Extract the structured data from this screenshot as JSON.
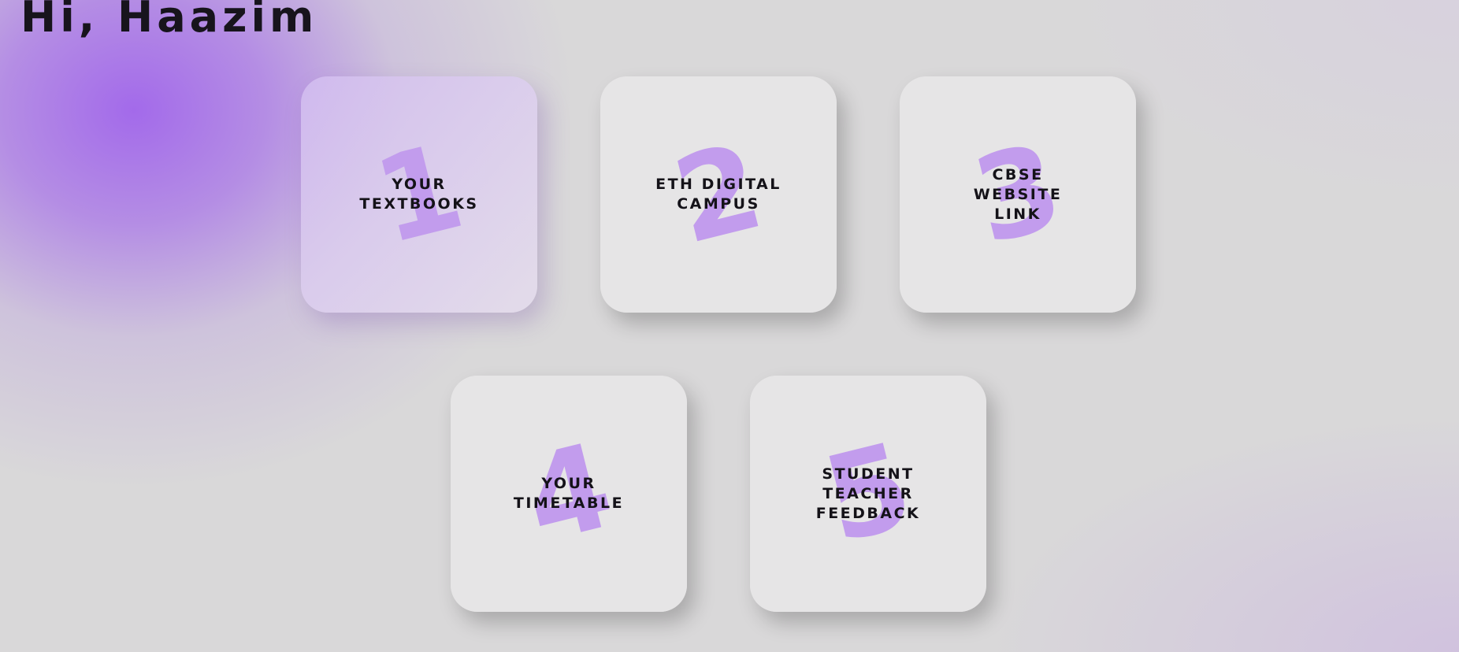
{
  "greeting": "Hi, Haazim",
  "cards": [
    {
      "number": "1",
      "label": "YOUR TEXTBOOKS"
    },
    {
      "number": "2",
      "label": "ETH DIGITAL CAMPUS"
    },
    {
      "number": "3",
      "label": "CBSE WEBSITE LINK"
    },
    {
      "number": "4",
      "label": "YOUR TIMETABLE"
    },
    {
      "number": "5",
      "label": "STUDENT TEACHER FEEDBACK"
    }
  ],
  "colors": {
    "accent": "#a36aeb",
    "numeral": "#c29ced",
    "text": "#17141c",
    "card": "#e7e6e7",
    "background": "#d9d8d9"
  }
}
